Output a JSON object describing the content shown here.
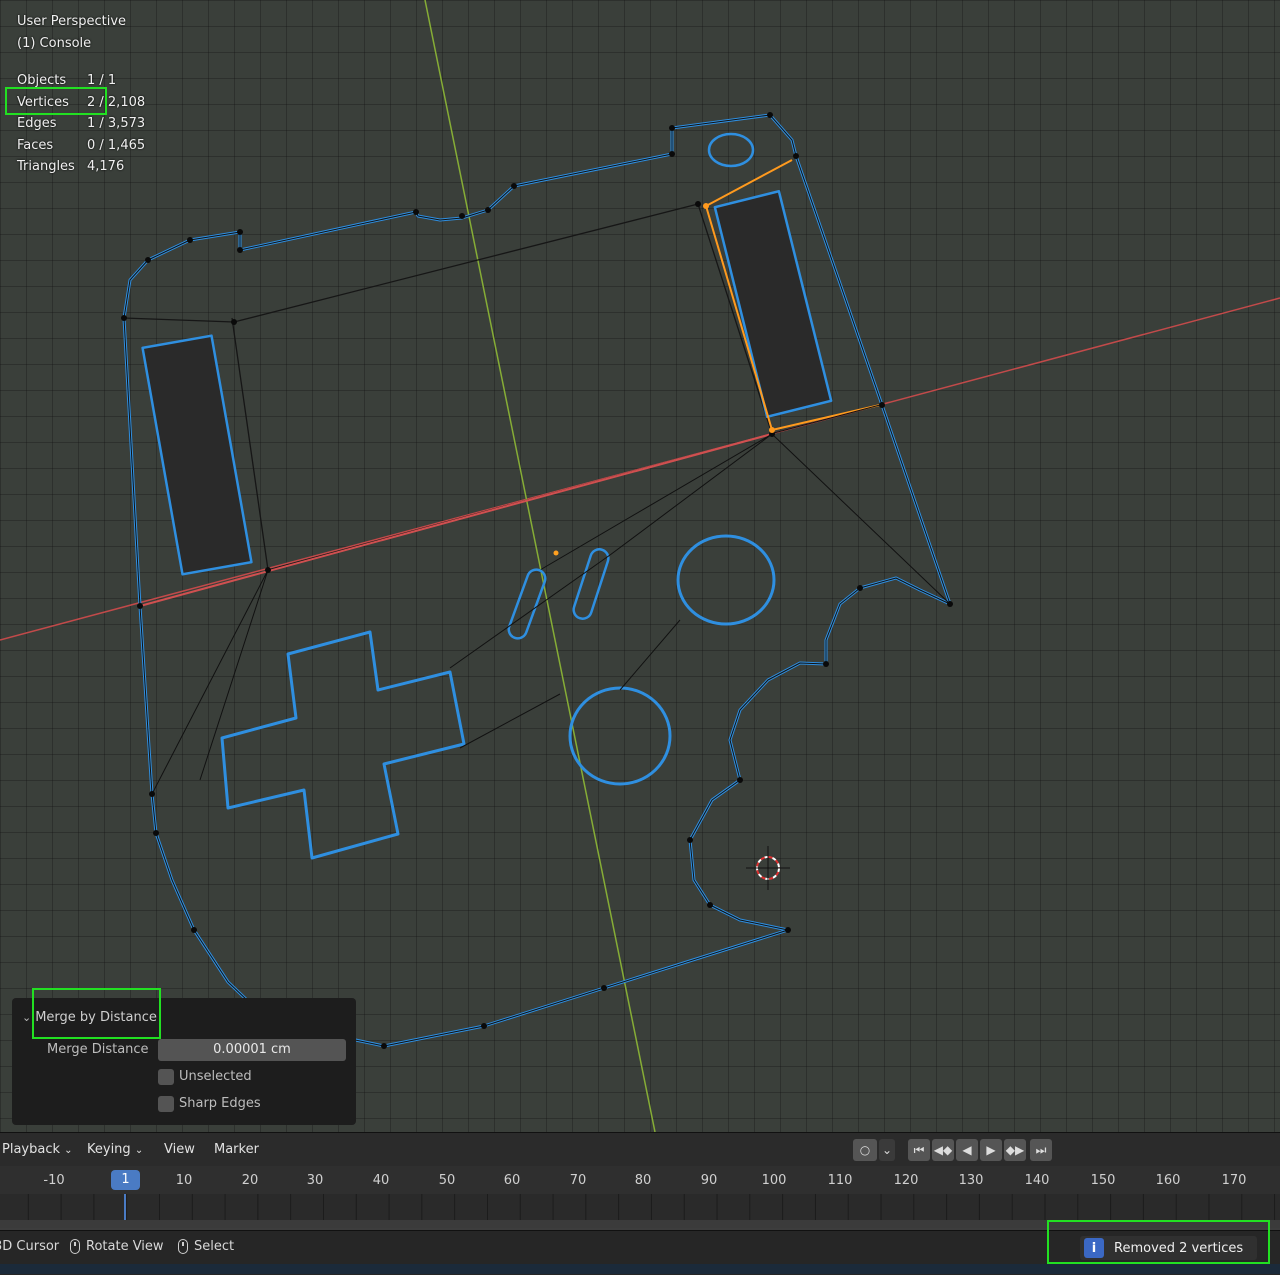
{
  "viewport": {
    "view_name": "User Perspective",
    "object_name": "(1) Console",
    "stats": [
      {
        "label": "Objects",
        "value": "1 / 1"
      },
      {
        "label": "Vertices",
        "value": "2 / 2,108"
      },
      {
        "label": "Edges",
        "value": "1 / 3,573"
      },
      {
        "label": "Faces",
        "value": "0 / 1,465"
      },
      {
        "label": "Triangles",
        "value": "4,176"
      }
    ]
  },
  "operator_panel": {
    "title": "Merge by Distance",
    "merge_distance_label": "Merge Distance",
    "merge_distance_value": "0.00001 cm",
    "unselected_label": "Unselected",
    "unselected_checked": false,
    "sharp_edges_label": "Sharp Edges",
    "sharp_edges_checked": false
  },
  "timeline": {
    "menus": [
      "Playback",
      "Keying",
      "View",
      "Marker"
    ],
    "current_frame": "1",
    "ticks": [
      "-10",
      "10",
      "20",
      "30",
      "40",
      "50",
      "60",
      "70",
      "80",
      "90",
      "100",
      "110",
      "120",
      "130",
      "140",
      "150",
      "160",
      "170"
    ]
  },
  "statusbar": {
    "cursor_label": "3D Cursor",
    "rotate_label": "Rotate View",
    "select_label": "Select",
    "report": "Removed 2 vertices"
  },
  "colors": {
    "edge_blue": "#2f8fe0",
    "selected_orange": "#ff9a1e",
    "highlight_green": "#22e022",
    "axis_red": "#d04848",
    "axis_green": "#8ab33a"
  }
}
